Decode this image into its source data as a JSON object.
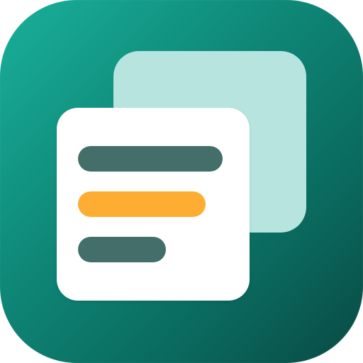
{
  "icon": {
    "name": "documents-app-icon",
    "colors": {
      "background_start": "#19b09a",
      "background_end": "#094a44",
      "back_card": "#b7e4df",
      "front_card": "#ffffff",
      "line_dark": "#436e69",
      "line_accent": "#fdad31"
    },
    "lines": [
      {
        "name": "text-line-1",
        "color": "#436e69"
      },
      {
        "name": "text-line-2-highlight",
        "color": "#fdad31"
      },
      {
        "name": "text-line-3",
        "color": "#436e69"
      }
    ]
  }
}
